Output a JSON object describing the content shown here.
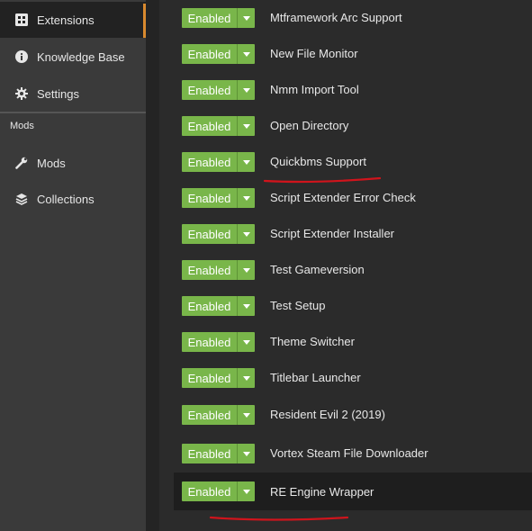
{
  "sidebar": {
    "items": [
      {
        "label": "Extensions",
        "icon": "extensions-icon"
      },
      {
        "label": "Knowledge Base",
        "icon": "info-icon"
      },
      {
        "label": "Settings",
        "icon": "gear-icon"
      }
    ],
    "section_title": "Mods",
    "mods_items": [
      {
        "label": "Mods",
        "icon": "wrench-icon"
      },
      {
        "label": "Collections",
        "icon": "layers-icon"
      }
    ]
  },
  "extensions": [
    {
      "status": "Enabled",
      "name": "Mtframework Arc Support"
    },
    {
      "status": "Enabled",
      "name": "New File Monitor"
    },
    {
      "status": "Enabled",
      "name": "Nmm Import Tool"
    },
    {
      "status": "Enabled",
      "name": "Open Directory"
    },
    {
      "status": "Enabled",
      "name": "Quickbms Support"
    },
    {
      "status": "Enabled",
      "name": "Script Extender Error Check"
    },
    {
      "status": "Enabled",
      "name": "Script Extender Installer"
    },
    {
      "status": "Enabled",
      "name": "Test Gameversion"
    },
    {
      "status": "Enabled",
      "name": "Test Setup"
    },
    {
      "status": "Enabled",
      "name": "Theme Switcher"
    },
    {
      "status": "Enabled",
      "name": "Titlebar Launcher"
    },
    {
      "status": "Enabled",
      "name": "Resident Evil 2 (2019)"
    },
    {
      "status": "Enabled",
      "name": "Vortex Steam File Downloader"
    },
    {
      "status": "Enabled",
      "name": "RE Engine Wrapper"
    }
  ],
  "colors": {
    "accent": "#d98a2f",
    "enabled_green": "#79b64a",
    "annotation_red": "#d0141c"
  }
}
